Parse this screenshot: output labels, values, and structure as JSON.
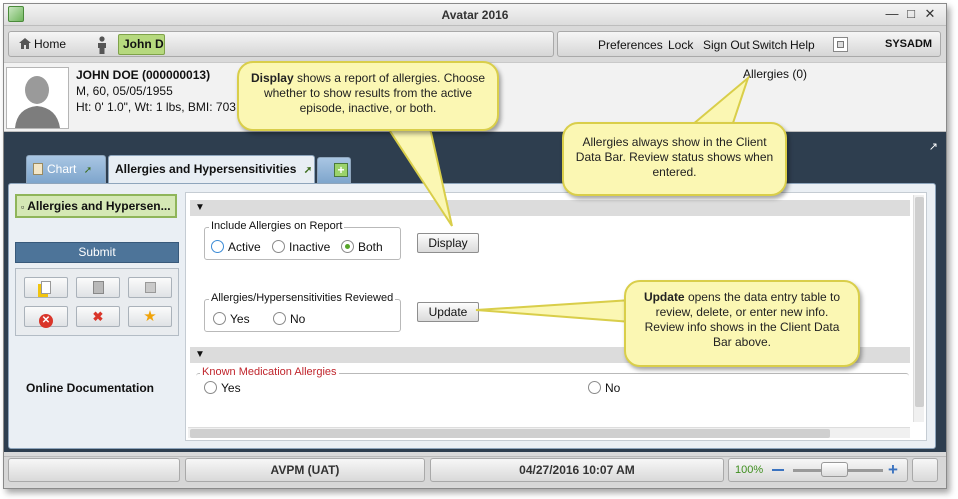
{
  "window": {
    "title": "Avatar 2016",
    "minimize": "—",
    "maximize": "□",
    "close": "✕"
  },
  "navbar": {
    "home": "Home",
    "client": "John D",
    "links": [
      "Preferences",
      "Lock",
      "Sign Out",
      "Switch",
      "Help"
    ],
    "user": "SYSADM"
  },
  "databar": {
    "name": "JOHN DOE (000000013)",
    "demo": "M, 60, 05/05/1955",
    "vitals": "Ht: 0' 1.0\", Wt: 1 lbs, BMI: 703",
    "allergies": "Allergies (0)"
  },
  "tabs": {
    "chart": "Chart",
    "active": "Allergies and Hypersensitivities"
  },
  "left_panel": {
    "section": "Allergies and Hypersen...",
    "submit": "Submit",
    "online_doc": "Online Documentation"
  },
  "form": {
    "include_legend": "Include Allergies on Report",
    "include_options": [
      "Active",
      "Inactive",
      "Both"
    ],
    "include_selected": "Both",
    "display_button": "Display",
    "reviewed_legend": "Allergies/Hypersensitivities Reviewed",
    "reviewed_options": [
      "Yes",
      "No"
    ],
    "update_button": "Update",
    "known_legend": "Known Medication Allergies",
    "known_options": [
      "Yes",
      "No"
    ],
    "collapse_glyph": "▼"
  },
  "statusbar": {
    "system": "AVPM (UAT)",
    "datetime": "04/27/2016 10:07 AM",
    "zoom": "100%"
  },
  "callouts": {
    "display_bold": "Display",
    "display_text": " shows a report of allergies.  Choose whether to show results from the active episode, inactive, or both.",
    "databar_text": "Allergies always show in the Client Data Bar.  Review status shows when entered.",
    "update_bold": "Update",
    "update_text": " opens the data entry table to review, delete, or enter new info.  Review info shows in the Client Data Bar above."
  },
  "colors": {
    "accent_green": "#b6d97e",
    "submit_blue": "#4d7499",
    "callout_yellow": "#fbf7b3",
    "header_dark": "#2e3e4f"
  }
}
